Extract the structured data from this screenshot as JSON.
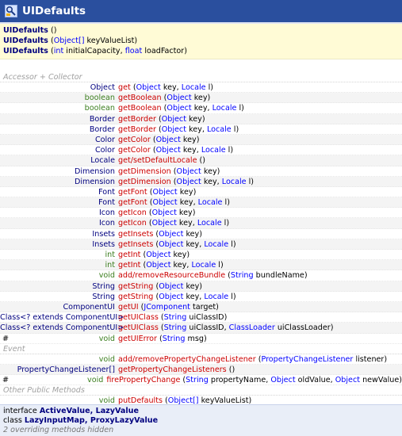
{
  "window": {
    "title": "UIDefaults",
    "icon": "class-icon"
  },
  "constructors": [
    {
      "name": "UIDefaults",
      "params": []
    },
    {
      "name": "UIDefaults",
      "params": [
        {
          "type": "Object[]",
          "name": "keyValueList"
        }
      ]
    },
    {
      "name": "UIDefaults",
      "params": [
        {
          "type": "int",
          "name": "initialCapacity"
        },
        {
          "type": "float",
          "name": "loadFactor"
        }
      ]
    }
  ],
  "sections": [
    {
      "title": "Accessor + Collector",
      "rows": [
        {
          "ret": "Object",
          "name": "get",
          "params": [
            {
              "type": "Object",
              "name": "key"
            },
            {
              "type": "Locale",
              "name": "l"
            }
          ]
        },
        {
          "ret": "boolean",
          "name": "getBoolean",
          "params": [
            {
              "type": "Object",
              "name": "key"
            }
          ]
        },
        {
          "ret": "boolean",
          "name": "getBoolean",
          "params": [
            {
              "type": "Object",
              "name": "key"
            },
            {
              "type": "Locale",
              "name": "l"
            }
          ]
        },
        {
          "ret": "Border",
          "name": "getBorder",
          "params": [
            {
              "type": "Object",
              "name": "key"
            }
          ]
        },
        {
          "ret": "Border",
          "name": "getBorder",
          "params": [
            {
              "type": "Object",
              "name": "key"
            },
            {
              "type": "Locale",
              "name": "l"
            }
          ]
        },
        {
          "ret": "Color",
          "name": "getColor",
          "params": [
            {
              "type": "Object",
              "name": "key"
            }
          ]
        },
        {
          "ret": "Color",
          "name": "getColor",
          "params": [
            {
              "type": "Object",
              "name": "key"
            },
            {
              "type": "Locale",
              "name": "l"
            }
          ]
        },
        {
          "ret": "Locale",
          "name": "get/setDefaultLocale",
          "params": []
        },
        {
          "ret": "Dimension",
          "name": "getDimension",
          "params": [
            {
              "type": "Object",
              "name": "key"
            }
          ]
        },
        {
          "ret": "Dimension",
          "name": "getDimension",
          "params": [
            {
              "type": "Object",
              "name": "key"
            },
            {
              "type": "Locale",
              "name": "l"
            }
          ]
        },
        {
          "ret": "Font",
          "name": "getFont",
          "params": [
            {
              "type": "Object",
              "name": "key"
            }
          ]
        },
        {
          "ret": "Font",
          "name": "getFont",
          "params": [
            {
              "type": "Object",
              "name": "key"
            },
            {
              "type": "Locale",
              "name": "l"
            }
          ]
        },
        {
          "ret": "Icon",
          "name": "getIcon",
          "params": [
            {
              "type": "Object",
              "name": "key"
            }
          ]
        },
        {
          "ret": "Icon",
          "name": "getIcon",
          "params": [
            {
              "type": "Object",
              "name": "key"
            },
            {
              "type": "Locale",
              "name": "l"
            }
          ]
        },
        {
          "ret": "Insets",
          "name": "getInsets",
          "params": [
            {
              "type": "Object",
              "name": "key"
            }
          ]
        },
        {
          "ret": "Insets",
          "name": "getInsets",
          "params": [
            {
              "type": "Object",
              "name": "key"
            },
            {
              "type": "Locale",
              "name": "l"
            }
          ]
        },
        {
          "ret": "int",
          "name": "getInt",
          "params": [
            {
              "type": "Object",
              "name": "key"
            }
          ]
        },
        {
          "ret": "int",
          "name": "getInt",
          "params": [
            {
              "type": "Object",
              "name": "key"
            },
            {
              "type": "Locale",
              "name": "l"
            }
          ]
        },
        {
          "ret": "void",
          "name": "add/removeResourceBundle",
          "params": [
            {
              "type": "String",
              "name": "bundleName"
            }
          ]
        },
        {
          "ret": "String",
          "name": "getString",
          "params": [
            {
              "type": "Object",
              "name": "key"
            }
          ]
        },
        {
          "ret": "String",
          "name": "getString",
          "params": [
            {
              "type": "Object",
              "name": "key"
            },
            {
              "type": "Locale",
              "name": "l"
            }
          ]
        },
        {
          "ret": "ComponentUI",
          "name": "getUI",
          "params": [
            {
              "type": "JComponent",
              "name": "target"
            }
          ]
        },
        {
          "ret": "Class<? extends ComponentUI>",
          "name": "getUIClass",
          "params": [
            {
              "type": "String",
              "name": "uiClassID"
            }
          ]
        },
        {
          "ret": "Class<? extends ComponentUI>",
          "name": "getUIClass",
          "params": [
            {
              "type": "String",
              "name": "uiClassID"
            },
            {
              "type": "ClassLoader",
              "name": "uiClassLoader"
            }
          ]
        },
        {
          "mark": "#",
          "ret": "void",
          "name": "getUIError",
          "params": [
            {
              "type": "String",
              "name": "msg"
            }
          ]
        }
      ]
    },
    {
      "title": "Event",
      "rows": [
        {
          "ret": "void",
          "name": "add/removePropertyChangeListener",
          "params": [
            {
              "type": "PropertyChangeListener",
              "name": "listener"
            }
          ]
        },
        {
          "ret": "PropertyChangeListener[]",
          "name": "getPropertyChangeListeners",
          "params": []
        },
        {
          "mark": "#",
          "ret": "void",
          "name": "firePropertyChange",
          "params": [
            {
              "type": "String",
              "name": "propertyName"
            },
            {
              "type": "Object",
              "name": "oldValue"
            },
            {
              "type": "Object",
              "name": "newValue"
            }
          ]
        }
      ]
    },
    {
      "title": "Other Public Methods",
      "rows": [
        {
          "ret": "void",
          "name": "putDefaults",
          "params": [
            {
              "type": "Object[]",
              "name": "keyValueList"
            }
          ]
        }
      ]
    }
  ],
  "footer": {
    "interface_keyword": "interface",
    "interfaces": "ActiveValue, LazyValue",
    "class_keyword": "class",
    "classes": "LazyInputMap, ProxyLazyValue",
    "overriding_count": "2",
    "overriding_label": "overriding",
    "hidden_label": "methods hidden"
  },
  "colors": {
    "title_bar": "#2a4f9e",
    "constructor_bg": "#fffbd6",
    "return_type": "#00007f",
    "primitive_return": "#3b7e1e",
    "method_name": "#cc0000",
    "param_type": "#0000ff",
    "section_title": "#a0a0a0"
  }
}
